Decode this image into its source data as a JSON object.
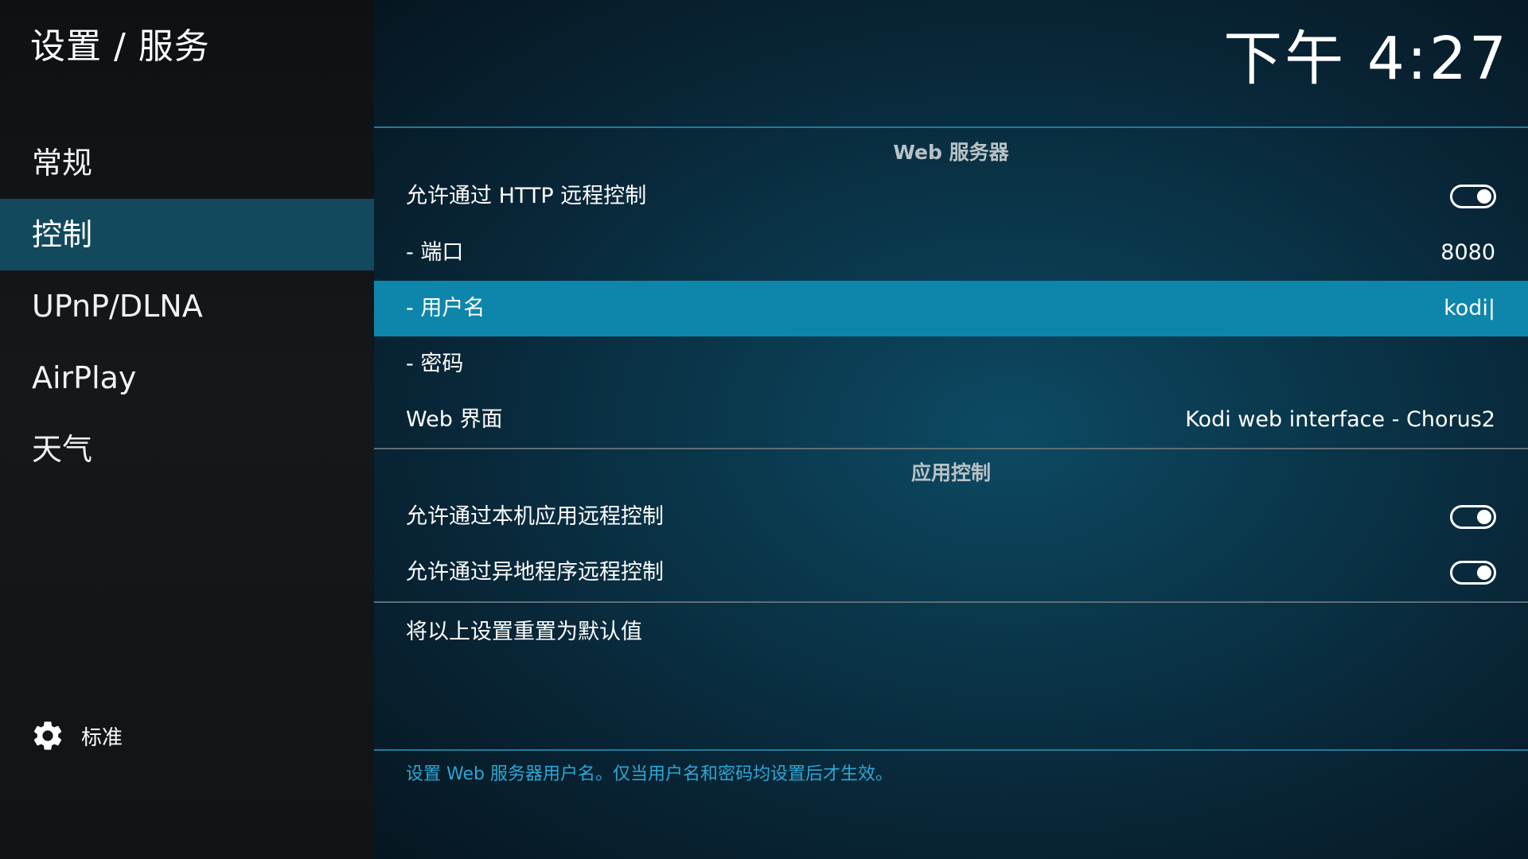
{
  "header": {
    "breadcrumb": "设置 / 服务",
    "clock": "下午 4:27"
  },
  "sidebar": {
    "items": [
      {
        "label": "常规",
        "selected": false
      },
      {
        "label": "控制",
        "selected": true
      },
      {
        "label": "UPnP/DLNA",
        "selected": false
      },
      {
        "label": "AirPlay",
        "selected": false
      },
      {
        "label": "天气",
        "selected": false
      }
    ],
    "level": {
      "icon": "gear-icon",
      "label": "标准"
    }
  },
  "main": {
    "groups": [
      {
        "title": "Web 服务器"
      },
      {
        "title": "应用控制"
      }
    ],
    "rows": [
      {
        "label": "允许通过 HTTP 远程控制",
        "type": "toggle",
        "on": true
      },
      {
        "label": "- 端口",
        "value": "8080"
      },
      {
        "label": "- 用户名",
        "value": "kodi|",
        "focused": true
      },
      {
        "label": "- 密码",
        "value": ""
      },
      {
        "label": "Web 界面",
        "value": "Kodi web interface - Chorus2"
      },
      {
        "label": "允许通过本机应用远程控制",
        "type": "toggle",
        "on": true
      },
      {
        "label": "允许通过异地程序远程控制",
        "type": "toggle",
        "on": true
      },
      {
        "label": "将以上设置重置为默认值"
      }
    ],
    "hint": "设置 Web 服务器用户名。仅当用户名和密码均设置后才生效。"
  },
  "colors": {
    "selected_nav": "#12495c",
    "focused_row": "#0e86ab",
    "hint_text": "#2ea7d4",
    "accent_divider": "#1f7d98"
  }
}
